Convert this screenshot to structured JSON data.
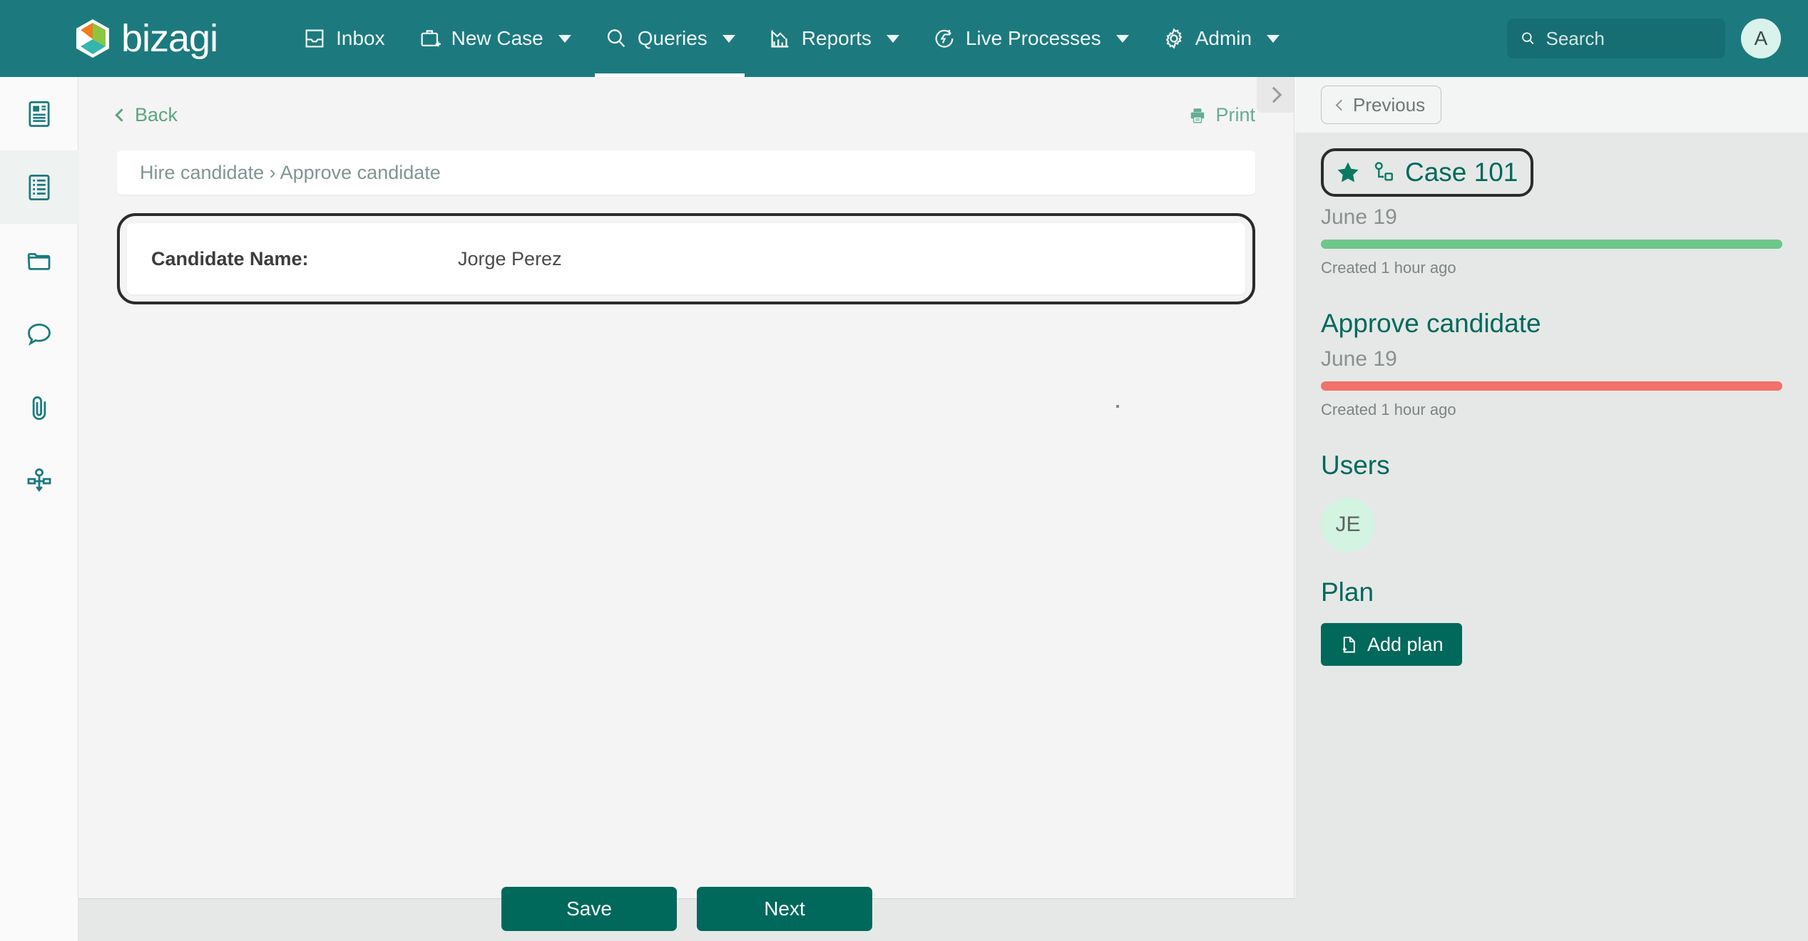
{
  "brand": {
    "name": "bizagi",
    "logo_icon": "bizagi-hexagon-logo"
  },
  "topnav": {
    "items": [
      {
        "label": "Inbox",
        "icon": "inbox-icon",
        "caret": false,
        "active": false
      },
      {
        "label": "New Case",
        "icon": "briefcase-plus-icon",
        "caret": true,
        "active": false
      },
      {
        "label": "Queries",
        "icon": "search-icon",
        "caret": true,
        "active": true
      },
      {
        "label": "Reports",
        "icon": "chart-icon",
        "caret": true,
        "active": false
      },
      {
        "label": "Live Processes",
        "icon": "live-processes-icon",
        "caret": true,
        "active": false
      },
      {
        "label": "Admin",
        "icon": "gear-icon",
        "caret": true,
        "active": false
      }
    ],
    "search": {
      "placeholder": "Search",
      "value": "",
      "icon": "search-icon"
    },
    "avatar": {
      "initials": "A"
    }
  },
  "sidebar": {
    "items": [
      {
        "icon": "summary-document-icon",
        "active": false
      },
      {
        "icon": "form-checklist-icon",
        "active": true
      },
      {
        "icon": "folder-icon",
        "active": false
      },
      {
        "icon": "comment-bubble-icon",
        "active": false
      },
      {
        "icon": "paperclip-icon",
        "active": false
      },
      {
        "icon": "process-diagram-icon",
        "active": false
      }
    ]
  },
  "main": {
    "back_label": "Back",
    "back_icon": "chevron-left-icon",
    "print_label": "Print",
    "print_icon": "printer-icon",
    "collapse_icon": "chevron-right-icon",
    "breadcrumb": "Hire candidate › Approve candidate",
    "form": {
      "field_label": "Candidate Name:",
      "field_value": "Jorge Perez"
    }
  },
  "right_panel": {
    "previous_label": "Previous",
    "previous_icon": "chevron-left-icon",
    "case": {
      "title": "Case 101",
      "star_icon": "star-filled-icon",
      "flow_icon": "process-flow-icon",
      "date": "June 19",
      "bar_color": "#6cc78a",
      "created": "Created 1 hour ago"
    },
    "activity": {
      "title": "Approve candidate",
      "date": "June 19",
      "bar_color": "#f0726a",
      "created": "Created 1 hour ago"
    },
    "users": {
      "title": "Users",
      "avatars": [
        {
          "initials": "JE"
        }
      ]
    },
    "plan": {
      "title": "Plan",
      "add_label": "Add plan",
      "add_icon": "document-plus-icon"
    }
  },
  "footer": {
    "save_label": "Save",
    "next_label": "Next"
  },
  "colors": {
    "brand_teal": "#1c7a7e",
    "accent_green": "#00695c",
    "progress_green": "#6cc78a",
    "progress_red": "#f0726a",
    "panel_bg": "#e5e8e7",
    "main_bg": "#f4f4f4"
  }
}
